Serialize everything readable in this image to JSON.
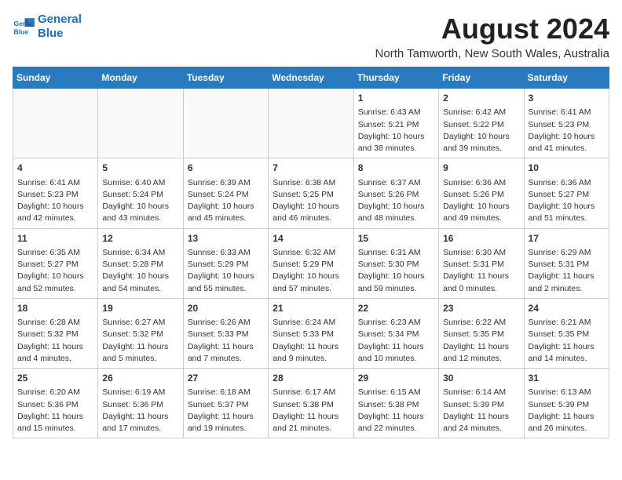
{
  "logo": {
    "line1": "General",
    "line2": "Blue"
  },
  "title": "August 2024",
  "subtitle": "North Tamworth, New South Wales, Australia",
  "weekdays": [
    "Sunday",
    "Monday",
    "Tuesday",
    "Wednesday",
    "Thursday",
    "Friday",
    "Saturday"
  ],
  "weeks": [
    [
      {
        "day": "",
        "info": ""
      },
      {
        "day": "",
        "info": ""
      },
      {
        "day": "",
        "info": ""
      },
      {
        "day": "",
        "info": ""
      },
      {
        "day": "1",
        "info": "Sunrise: 6:43 AM\nSunset: 5:21 PM\nDaylight: 10 hours\nand 38 minutes."
      },
      {
        "day": "2",
        "info": "Sunrise: 6:42 AM\nSunset: 5:22 PM\nDaylight: 10 hours\nand 39 minutes."
      },
      {
        "day": "3",
        "info": "Sunrise: 6:41 AM\nSunset: 5:23 PM\nDaylight: 10 hours\nand 41 minutes."
      }
    ],
    [
      {
        "day": "4",
        "info": "Sunrise: 6:41 AM\nSunset: 5:23 PM\nDaylight: 10 hours\nand 42 minutes."
      },
      {
        "day": "5",
        "info": "Sunrise: 6:40 AM\nSunset: 5:24 PM\nDaylight: 10 hours\nand 43 minutes."
      },
      {
        "day": "6",
        "info": "Sunrise: 6:39 AM\nSunset: 5:24 PM\nDaylight: 10 hours\nand 45 minutes."
      },
      {
        "day": "7",
        "info": "Sunrise: 6:38 AM\nSunset: 5:25 PM\nDaylight: 10 hours\nand 46 minutes."
      },
      {
        "day": "8",
        "info": "Sunrise: 6:37 AM\nSunset: 5:26 PM\nDaylight: 10 hours\nand 48 minutes."
      },
      {
        "day": "9",
        "info": "Sunrise: 6:36 AM\nSunset: 5:26 PM\nDaylight: 10 hours\nand 49 minutes."
      },
      {
        "day": "10",
        "info": "Sunrise: 6:36 AM\nSunset: 5:27 PM\nDaylight: 10 hours\nand 51 minutes."
      }
    ],
    [
      {
        "day": "11",
        "info": "Sunrise: 6:35 AM\nSunset: 5:27 PM\nDaylight: 10 hours\nand 52 minutes."
      },
      {
        "day": "12",
        "info": "Sunrise: 6:34 AM\nSunset: 5:28 PM\nDaylight: 10 hours\nand 54 minutes."
      },
      {
        "day": "13",
        "info": "Sunrise: 6:33 AM\nSunset: 5:29 PM\nDaylight: 10 hours\nand 55 minutes."
      },
      {
        "day": "14",
        "info": "Sunrise: 6:32 AM\nSunset: 5:29 PM\nDaylight: 10 hours\nand 57 minutes."
      },
      {
        "day": "15",
        "info": "Sunrise: 6:31 AM\nSunset: 5:30 PM\nDaylight: 10 hours\nand 59 minutes."
      },
      {
        "day": "16",
        "info": "Sunrise: 6:30 AM\nSunset: 5:31 PM\nDaylight: 11 hours\nand 0 minutes."
      },
      {
        "day": "17",
        "info": "Sunrise: 6:29 AM\nSunset: 5:31 PM\nDaylight: 11 hours\nand 2 minutes."
      }
    ],
    [
      {
        "day": "18",
        "info": "Sunrise: 6:28 AM\nSunset: 5:32 PM\nDaylight: 11 hours\nand 4 minutes."
      },
      {
        "day": "19",
        "info": "Sunrise: 6:27 AM\nSunset: 5:32 PM\nDaylight: 11 hours\nand 5 minutes."
      },
      {
        "day": "20",
        "info": "Sunrise: 6:26 AM\nSunset: 5:33 PM\nDaylight: 11 hours\nand 7 minutes."
      },
      {
        "day": "21",
        "info": "Sunrise: 6:24 AM\nSunset: 5:33 PM\nDaylight: 11 hours\nand 9 minutes."
      },
      {
        "day": "22",
        "info": "Sunrise: 6:23 AM\nSunset: 5:34 PM\nDaylight: 11 hours\nand 10 minutes."
      },
      {
        "day": "23",
        "info": "Sunrise: 6:22 AM\nSunset: 5:35 PM\nDaylight: 11 hours\nand 12 minutes."
      },
      {
        "day": "24",
        "info": "Sunrise: 6:21 AM\nSunset: 5:35 PM\nDaylight: 11 hours\nand 14 minutes."
      }
    ],
    [
      {
        "day": "25",
        "info": "Sunrise: 6:20 AM\nSunset: 5:36 PM\nDaylight: 11 hours\nand 15 minutes."
      },
      {
        "day": "26",
        "info": "Sunrise: 6:19 AM\nSunset: 5:36 PM\nDaylight: 11 hours\nand 17 minutes."
      },
      {
        "day": "27",
        "info": "Sunrise: 6:18 AM\nSunset: 5:37 PM\nDaylight: 11 hours\nand 19 minutes."
      },
      {
        "day": "28",
        "info": "Sunrise: 6:17 AM\nSunset: 5:38 PM\nDaylight: 11 hours\nand 21 minutes."
      },
      {
        "day": "29",
        "info": "Sunrise: 6:15 AM\nSunset: 5:38 PM\nDaylight: 11 hours\nand 22 minutes."
      },
      {
        "day": "30",
        "info": "Sunrise: 6:14 AM\nSunset: 5:39 PM\nDaylight: 11 hours\nand 24 minutes."
      },
      {
        "day": "31",
        "info": "Sunrise: 6:13 AM\nSunset: 5:39 PM\nDaylight: 11 hours\nand 26 minutes."
      }
    ]
  ]
}
